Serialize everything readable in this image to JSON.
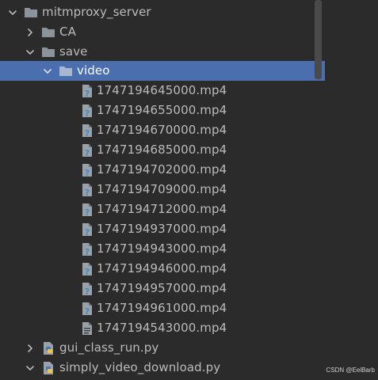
{
  "tree": {
    "root": {
      "label": "mitmproxy_server",
      "expanded": true,
      "icon": "folder-icon"
    },
    "ca": {
      "label": "CA",
      "expanded": false,
      "icon": "folder-icon"
    },
    "save": {
      "label": "save",
      "expanded": true,
      "icon": "folder-icon"
    },
    "video": {
      "label": "video",
      "expanded": true,
      "selected": true,
      "icon": "folder-icon"
    },
    "files": [
      {
        "label": "1747194645000.mp4",
        "icon": "unknown-file-icon"
      },
      {
        "label": "1747194655000.mp4",
        "icon": "unknown-file-icon"
      },
      {
        "label": "1747194670000.mp4",
        "icon": "unknown-file-icon"
      },
      {
        "label": "1747194685000.mp4",
        "icon": "unknown-file-icon"
      },
      {
        "label": "1747194702000.mp4",
        "icon": "unknown-file-icon"
      },
      {
        "label": "1747194709000.mp4",
        "icon": "unknown-file-icon"
      },
      {
        "label": "1747194712000.mp4",
        "icon": "unknown-file-icon"
      },
      {
        "label": "1747194937000.mp4",
        "icon": "unknown-file-icon"
      },
      {
        "label": "1747194943000.mp4",
        "icon": "unknown-file-icon"
      },
      {
        "label": "1747194946000.mp4",
        "icon": "unknown-file-icon"
      },
      {
        "label": "1747194957000.mp4",
        "icon": "unknown-file-icon"
      },
      {
        "label": "1747194961000.mp4",
        "icon": "unknown-file-icon"
      },
      {
        "label": "1747194543000.mp4",
        "icon": "text-file-icon"
      }
    ],
    "gui_class_run": {
      "label": "gui_class_run.py",
      "expanded": false,
      "icon": "python-file-icon"
    },
    "simply_video_download": {
      "label": "simply_video_download.py",
      "expanded": true,
      "icon": "python-file-icon"
    }
  },
  "watermark": "CSDN @EelBarb",
  "colors": {
    "background": "#2b2b2b",
    "selection": "#4b6eaf",
    "text": "#bbbbbb",
    "folder": "#8b949b",
    "file": "#9aa1a7",
    "question": "#3d8bd1",
    "python_blue": "#3b7bbf",
    "python_yellow": "#f6c343"
  }
}
